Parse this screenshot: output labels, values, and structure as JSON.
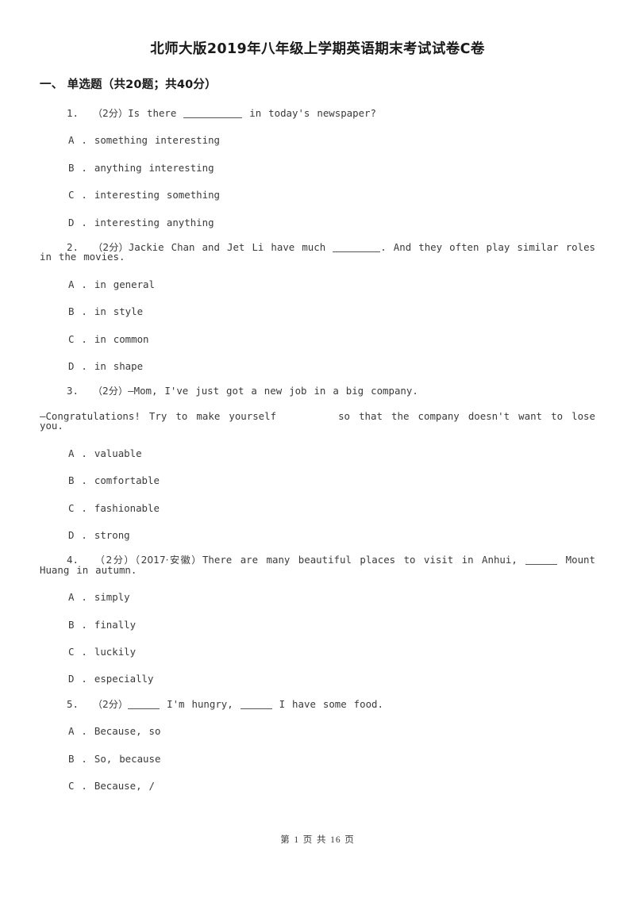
{
  "document": {
    "title": "北师大版2019年八年级上学期英语期末考试试卷C卷"
  },
  "section": {
    "label": "一、  单选题（共20题；共40分）"
  },
  "questions": [
    {
      "number": "1.",
      "points": "（2分）",
      "stem_before": "Is there",
      "stem_after": "in today's newspaper?",
      "blank_style": "w-long",
      "options": [
        {
          "letter": "A",
          "text": "something interesting"
        },
        {
          "letter": "B",
          "text": "anything interesting"
        },
        {
          "letter": "C",
          "text": "interesting something"
        },
        {
          "letter": "D",
          "text": "interesting anything"
        }
      ]
    },
    {
      "number": "2.",
      "points": "（2分）",
      "stem_before": "Jackie Chan and Jet Li have much",
      "stem_after": ". And they often play similar roles in the movies.",
      "blank_style": "w-med",
      "options": [
        {
          "letter": "A",
          "text": "in general"
        },
        {
          "letter": "B",
          "text": "in style"
        },
        {
          "letter": "C",
          "text": "in common"
        },
        {
          "letter": "D",
          "text": "in shape"
        }
      ]
    },
    {
      "number": "3.",
      "points": "（2分）",
      "line1": "—Mom, I've just got a new job in a big company.",
      "line2_before": "—Congratulations! Try to make yourself",
      "line2_after": "so that the company doesn't want to lose you.",
      "options": [
        {
          "letter": "A",
          "text": "valuable"
        },
        {
          "letter": "B",
          "text": "comfortable"
        },
        {
          "letter": "C",
          "text": "fashionable"
        },
        {
          "letter": "D",
          "text": "strong"
        }
      ]
    },
    {
      "number": "4.",
      "points": "（2分）",
      "source": "（2017·安徽）",
      "stem_before": "There are many beautiful places to visit in Anhui,",
      "stem_after": "Mount Huang in autumn.",
      "blank_style": "w-short",
      "options": [
        {
          "letter": "A",
          "text": "simply"
        },
        {
          "letter": "B",
          "text": "finally"
        },
        {
          "letter": "C",
          "text": "luckily"
        },
        {
          "letter": "D",
          "text": "especially"
        }
      ]
    },
    {
      "number": "5.",
      "points": "（2分）",
      "stem_mid": "I'm hungry,",
      "stem_after": "I have some food.",
      "options": [
        {
          "letter": "A",
          "text": "Because, so"
        },
        {
          "letter": "B",
          "text": "So, because"
        },
        {
          "letter": "C",
          "text": " Because, /"
        }
      ]
    }
  ],
  "footer": {
    "prefix": "第",
    "current_page": "1",
    "middle": "页 共",
    "total_pages": "16",
    "suffix": "页"
  }
}
